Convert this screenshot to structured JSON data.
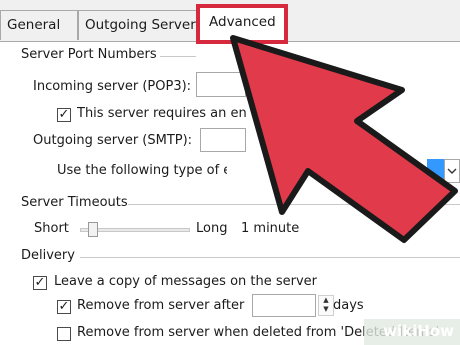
{
  "tabs": [
    {
      "label": "General"
    },
    {
      "label": "Outgoing Server"
    },
    {
      "label": "Advanced"
    }
  ],
  "server_ports": {
    "heading": "Server Port Numbers",
    "incoming_label": "Incoming server (POP3):",
    "incoming_value": "",
    "ssl_checkbox_label": "This server requires an encrypted connection (SSL)",
    "ssl_checked": true,
    "outgoing_label": "Outgoing server (SMTP):",
    "outgoing_value": "",
    "encryption_label": "Use the following type of encrypted connection:",
    "encryption_value": ""
  },
  "timeouts": {
    "heading": "Server Timeouts",
    "short_label": "Short",
    "long_label": "Long",
    "value_text": "1 minute"
  },
  "delivery": {
    "heading": "Delivery",
    "leave_copy_label": "Leave a copy of messages on the server",
    "leave_copy_checked": true,
    "remove_after_label": "Remove from server after",
    "remove_after_checked": true,
    "remove_after_value": "",
    "days_label": "days",
    "remove_deleted_label": "Remove from server when deleted from 'Deleted Items'",
    "remove_deleted_checked": false
  },
  "watermark": {
    "text": "wikiHow"
  },
  "colors": {
    "highlight": "#d6293d",
    "arrow": "#e13a4b",
    "selected_field": "#3399ff"
  },
  "icons": {
    "check": "✓",
    "spin_up": "▲",
    "spin_down": "▼",
    "dropdown": "chevron-down"
  }
}
